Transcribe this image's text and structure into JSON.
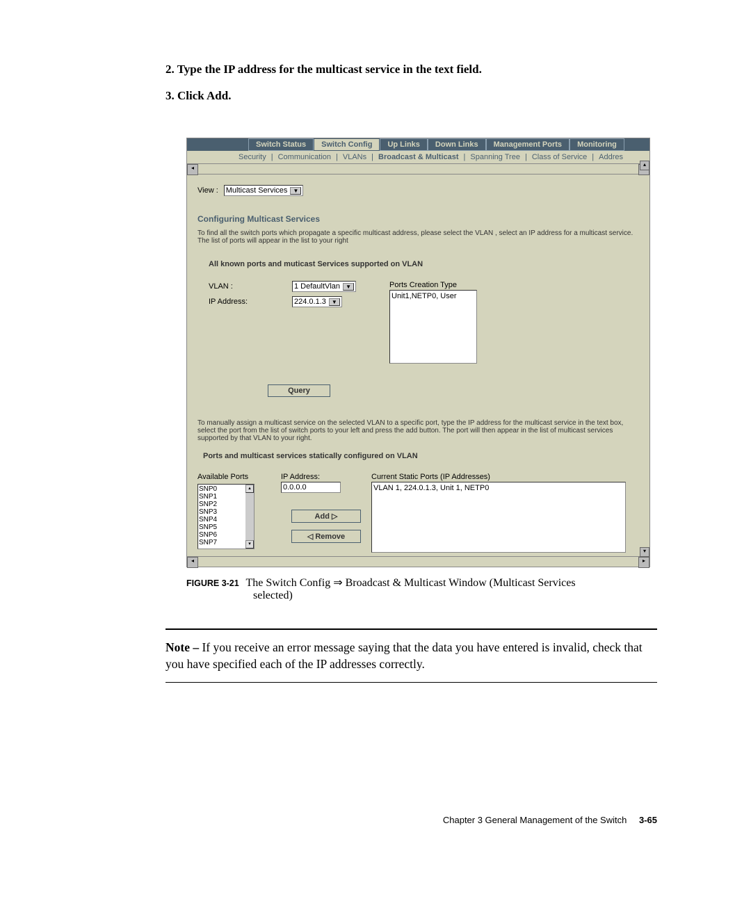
{
  "instructions": {
    "step2": "2. Type the IP address for the multicast service in the text field.",
    "step3": "3. Click Add."
  },
  "screenshot": {
    "top_tabs": {
      "switch_status": "Switch Status",
      "switch_config": "Switch Config",
      "up_links": "Up Links",
      "down_links": "Down Links",
      "management_ports": "Management Ports",
      "monitoring": "Monitoring"
    },
    "sub_tabs": {
      "security": "Security",
      "communication": "Communication",
      "vlans": "VLANs",
      "broadcast_multicast": "Broadcast & Multicast",
      "spanning_tree": "Spanning Tree",
      "class_of_service": "Class of Service",
      "address": "Addres"
    },
    "view": {
      "label": "View :",
      "value": "Multicast Services"
    },
    "section1": {
      "title": "Configuring Multicast Services",
      "info": "To find all the switch ports which propagate a specific multicast address, please select the VLAN , select an IP address for a multicast service. The list of ports will appear in the list to your right",
      "heading": "All known ports and muticast Services  supported on VLAN",
      "vlan_label": "VLAN :",
      "vlan_value": "1 DefaultVlan",
      "ip_label": "IP Address:",
      "ip_value": "224.0.1.3",
      "ports_creation_label": "Ports Creation Type",
      "ports_creation_value": "Unit1,NETP0, User",
      "query_btn": "Query"
    },
    "section2": {
      "info": "To manually assign a multicast service on the selected VLAN to a specific port, type the IP address for the multicast service in the text box, select the port from the list of switch ports to your left and press the add button. The port will then appear in the list of multicast services supported by that VLAN to your right.",
      "heading": "Ports and multicast services statically configured on VLAN",
      "available_ports_label": "Available Ports",
      "ports": [
        "SNP0",
        "SNP1",
        "SNP2",
        "SNP3",
        "SNP4",
        "SNP5",
        "SNP6",
        "SNP7"
      ],
      "ip_label": "IP Address:",
      "ip_value": "0.0.0.0",
      "add_btn": "Add  ▷",
      "remove_btn": "◁  Remove",
      "current_label": "Current Static Ports (IP Addresses)",
      "current_value": "VLAN 1, 224.0.1.3, Unit 1, NETP0"
    }
  },
  "figure": {
    "label": "FIGURE 3-21",
    "text1": "The Switch Config ⇒ Broadcast & Multicast Window (Multicast Services",
    "text2": "selected)"
  },
  "note": {
    "prefix": "Note – ",
    "text": "If you receive an error message saying that the data you have entered is invalid, check that you have specified each of the IP addresses correctly."
  },
  "footer": {
    "chapter": "Chapter 3   General Management of the Switch",
    "page": "3-65"
  }
}
